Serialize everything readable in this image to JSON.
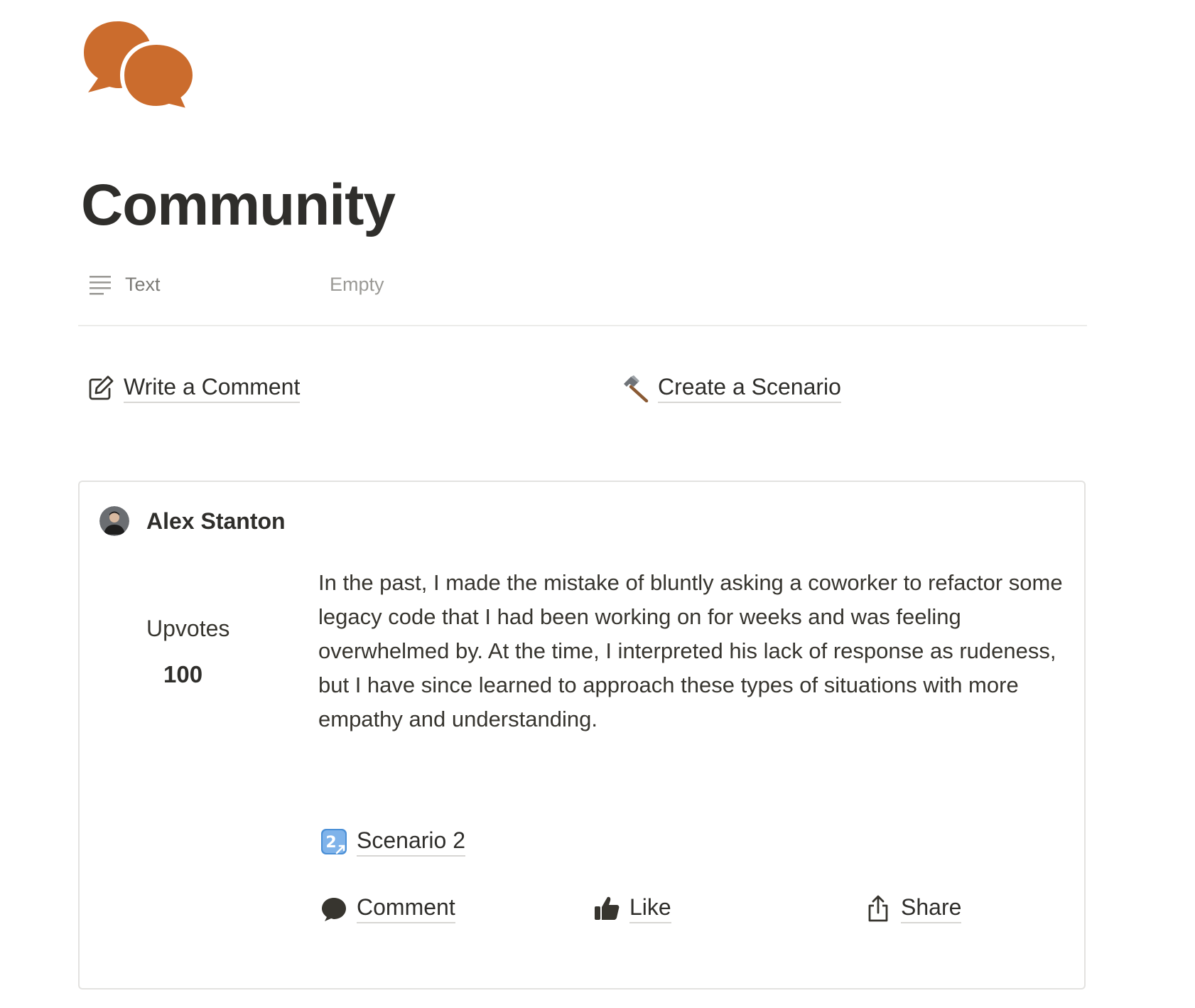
{
  "page": {
    "title": "Community",
    "icon": "speech-bubbles-icon",
    "accent_color": "#cb6c2d"
  },
  "property": {
    "icon": "text-lines-icon",
    "label": "Text",
    "value": "Empty"
  },
  "links": {
    "write_comment": {
      "label": "Write a Comment",
      "icon": "pencil-square-icon"
    },
    "create_scenario": {
      "label": "Create a Scenario",
      "icon": "hammer-icon"
    }
  },
  "comment_card": {
    "author": "Alex Stanton",
    "avatar": "avatar",
    "upvotes_label": "Upvotes",
    "upvotes_value": "100",
    "body": "In the past, I made the mistake of bluntly asking a coworker to refactor some legacy code that I had been working on for weeks and was feeling overwhelmed by. At the time, I interpreted his lack of response as rudeness, but I have since learned to approach these types of situations with more empathy and understanding.",
    "scenario_link": {
      "label": "Scenario 2",
      "icon": "keycap-two-icon"
    },
    "actions": {
      "comment": {
        "label": "Comment",
        "icon": "speech-bubble-icon"
      },
      "like": {
        "label": "Like",
        "icon": "thumbs-up-icon"
      },
      "share": {
        "label": "Share",
        "icon": "share-icon"
      }
    }
  }
}
